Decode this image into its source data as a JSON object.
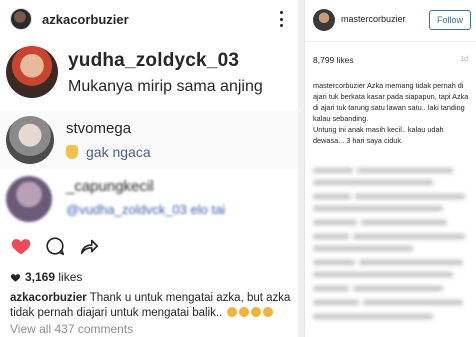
{
  "left": {
    "username": "azkacorbuzier",
    "comments": [
      {
        "user": "yudha_zoldyck_03",
        "text": "Mukanya mirip sama anjing"
      },
      {
        "user": "stvomega",
        "text": "gak ngaca"
      },
      {
        "user": "_capungkecil",
        "text": "@vudha_zoldvck_03 elo tai"
      }
    ],
    "likes_count": "3,169",
    "likes_label": "likes",
    "caption_user": "azkacorbuzier",
    "caption_text": "Thank u untuk mengatai azka, but azka tidak pernah diajari untuk mengatai balik..",
    "view_all": "View all 437 comments",
    "icons": [
      "kebab-menu-icon",
      "heart-icon",
      "comment-icon",
      "share-icon"
    ],
    "colors": {
      "heart": "#ed4956",
      "link": "#3f729b"
    }
  },
  "right": {
    "username": "mastercorbuzier",
    "follow_label": "Follow",
    "likes": "8,799 likes",
    "date": "1d",
    "caption_user": "mastercorbuzier",
    "caption": "Azka memang tidak pernah di ajari tuk berkata kasar pada siapapun, tapi Azka di ajari tuk tarung satu lawan satu.. laki tanding kalau sebanding.",
    "caption2": "Untung ini anak masih kecil.. kalau udah dewasa... 3 hari saya ciduk."
  }
}
